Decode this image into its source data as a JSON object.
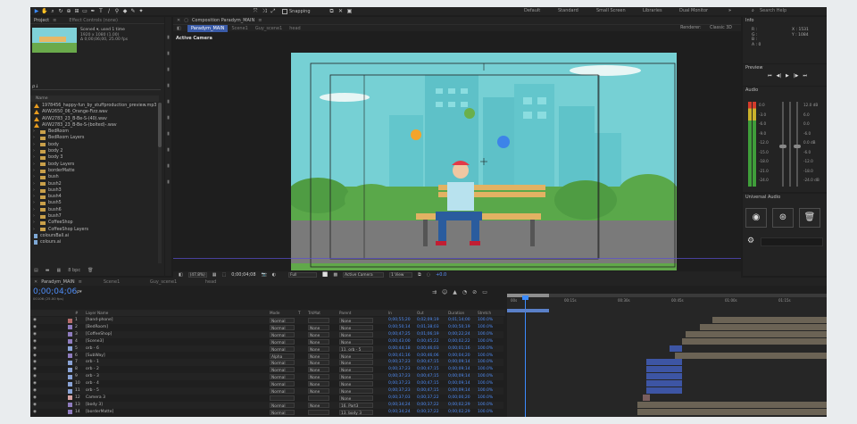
{
  "toolbar": {
    "snapping": "Snapping",
    "workspaces": [
      "Default",
      "Standard",
      "Small Screen",
      "Libraries",
      "Dual Monitor"
    ],
    "search_placeholder": "Search Help"
  },
  "project_panel": {
    "tab_project": "Project",
    "tab_effect_controls": "Effect Controls (none)",
    "selected_name": "Scene4 ▾, used 1 time",
    "selected_size": "1920 x 1080 (1.00)",
    "selected_duration": "Δ 0;00;06;00, 25.00 fps",
    "search_placeholder": "ρ↓",
    "column_name": "Name",
    "items": [
      {
        "name": "1978456_happy-fun_by_stuffproduction_preview.mp3",
        "type": "audio"
      },
      {
        "name": "AVW2650_06_Orange-Fizz.wav",
        "type": "audio"
      },
      {
        "name": "AVW2783_23_B-Be-S-(40).wav",
        "type": "audio"
      },
      {
        "name": "AVW2783_23_B-Be-S-(bolted)-.wav",
        "type": "audio"
      },
      {
        "name": "BedRoom",
        "type": "folder"
      },
      {
        "name": "BedRoom Layers",
        "type": "folder"
      },
      {
        "name": "body",
        "type": "folder"
      },
      {
        "name": "body 2",
        "type": "folder"
      },
      {
        "name": "body 3",
        "type": "folder"
      },
      {
        "name": "body Layers",
        "type": "folder"
      },
      {
        "name": "borderMatte",
        "type": "folder"
      },
      {
        "name": "bush",
        "type": "folder"
      },
      {
        "name": "bush2",
        "type": "folder"
      },
      {
        "name": "bush3",
        "type": "folder"
      },
      {
        "name": "bush4",
        "type": "folder"
      },
      {
        "name": "bush5",
        "type": "folder"
      },
      {
        "name": "bush6",
        "type": "folder"
      },
      {
        "name": "bush7",
        "type": "folder"
      },
      {
        "name": "CoffeeShop",
        "type": "folder"
      },
      {
        "name": "CoffeeShop Layers",
        "type": "folder"
      },
      {
        "name": "coloursBall.ai",
        "type": "file"
      },
      {
        "name": "colours.ai",
        "type": "file"
      }
    ],
    "bottom_bpc": "8 bpc"
  },
  "composition": {
    "panel_title": "Composition Paradym_MAIN",
    "breadcrumbs": [
      "Paradym_MAIN",
      "Scene1",
      "Guy_scene1",
      "head"
    ],
    "renderer_label": "Renderer:",
    "renderer_value": "Classic 3D",
    "active_camera": "Active Camera",
    "zoom": "(47.8%)",
    "timecode": "0;00;04;08",
    "resolution": "Full",
    "view_camera": "Active Camera",
    "views": "1 View",
    "exposure": "+0.0"
  },
  "info_panel": {
    "title": "Info",
    "r": "R :",
    "g": "G :",
    "b": "B :",
    "a": "A : 0",
    "x": "X : 1531",
    "y": "Y : 1084"
  },
  "preview_panel": {
    "title": "Preview"
  },
  "audio_panel": {
    "title": "Audio",
    "left_scale": [
      "0.0",
      "-3.0",
      "-6.0",
      "-9.0",
      "-12.0",
      "-15.0",
      "-18.0",
      "-21.0",
      "-24.0"
    ],
    "right_scale": [
      "12.0 dB",
      "6.0",
      "0.0",
      "-6.0",
      "0.0 dB",
      "-6.0",
      "-12.0",
      "-18.0",
      "-24.0 dB"
    ]
  },
  "universal_audio": {
    "title": "Universal Audio"
  },
  "timeline": {
    "tabs": [
      "Paradym_MAIN",
      "Scene1",
      "Guy_scene1",
      "head"
    ],
    "timecode": "0;00;04;06",
    "frame_info": "00106 (25.00 fps)",
    "columns": [
      "#",
      "Layer Name",
      "Mode",
      "T",
      "TrkMat",
      "Parent",
      "In",
      "Out",
      "Duration",
      "Stretch"
    ],
    "ruler": [
      "00s",
      "00:15s",
      "00:30s",
      "00:45s",
      "01:00s",
      "01:15s"
    ],
    "layers": [
      {
        "num": "1",
        "name": "[hand-phone]",
        "mode": "Normal",
        "trk": "",
        "parent": "None",
        "in": "0;00;55;20",
        "out": "0;02;09;19",
        "dur": "0;01;14;00",
        "stretch": "100.0%"
      },
      {
        "num": "2",
        "name": "[BedRoom]",
        "mode": "Normal",
        "trk": "None",
        "parent": "None",
        "in": "0;00;50;14",
        "out": "0;01;38;03",
        "dur": "0;00;50;19",
        "stretch": "100.0%"
      },
      {
        "num": "3",
        "name": "[CoffeeShop]",
        "mode": "Normal",
        "trk": "None",
        "parent": "None",
        "in": "0;00;47;25",
        "out": "0;01;06;19",
        "dur": "0;00;22;24",
        "stretch": "100.0%"
      },
      {
        "num": "4",
        "name": "[Scene3]",
        "mode": "Normal",
        "trk": "None",
        "parent": "None",
        "in": "0;00;43;00",
        "out": "0;00;45;22",
        "dur": "0;00;02;22",
        "stretch": "100.0%"
      },
      {
        "num": "5",
        "name": "orb - 6",
        "mode": "Normal",
        "trk": "None",
        "parent": "11. orb - 5",
        "in": "0;00;44;18",
        "out": "0;00;46;03",
        "dur": "0;00;01;16",
        "stretch": "100.0%"
      },
      {
        "num": "6",
        "name": "[SubWay]",
        "mode": "Alpha",
        "trk": "None",
        "parent": "None",
        "in": "0;00;41;16",
        "out": "0;00;46;06",
        "dur": "0;00;04;20",
        "stretch": "100.0%"
      },
      {
        "num": "7",
        "name": "orb - 1",
        "mode": "Normal",
        "trk": "None",
        "parent": "None",
        "in": "0;00;37;23",
        "out": "0;00;47;15",
        "dur": "0;00;09;14",
        "stretch": "100.0%"
      },
      {
        "num": "8",
        "name": "orb - 2",
        "mode": "Normal",
        "trk": "None",
        "parent": "None",
        "in": "0;00;37;23",
        "out": "0;00;47;15",
        "dur": "0;00;09;14",
        "stretch": "100.0%"
      },
      {
        "num": "9",
        "name": "orb - 3",
        "mode": "Normal",
        "trk": "None",
        "parent": "None",
        "in": "0;00;37;23",
        "out": "0;00;47;15",
        "dur": "0;00;09;14",
        "stretch": "100.0%"
      },
      {
        "num": "10",
        "name": "orb - 4",
        "mode": "Normal",
        "trk": "None",
        "parent": "None",
        "in": "0;00;37;23",
        "out": "0;00;47;15",
        "dur": "0;00;09;14",
        "stretch": "100.0%"
      },
      {
        "num": "11",
        "name": "orb - 5",
        "mode": "Normal",
        "trk": "None",
        "parent": "None",
        "in": "0;00;37;23",
        "out": "0;00;47;15",
        "dur": "0;00;09;14",
        "stretch": "100.0%"
      },
      {
        "num": "12",
        "name": "Camera 3",
        "mode": "",
        "trk": "",
        "parent": "None",
        "in": "0;00;37;03",
        "out": "0;00;37;22",
        "dur": "0;00;00;20",
        "stretch": "100.0%"
      },
      {
        "num": "13",
        "name": "[body 3]",
        "mode": "Normal",
        "trk": "None",
        "parent": "16. Part3",
        "in": "0;00;34;24",
        "out": "0;00;37;22",
        "dur": "0;00;02;29",
        "stretch": "100.0%"
      },
      {
        "num": "14",
        "name": "[borderMatte]",
        "mode": "Normal",
        "trk": "",
        "parent": "13. body 3",
        "in": "0;00;34;24",
        "out": "0;00;37;22",
        "dur": "0;00;02;29",
        "stretch": "100.0%"
      }
    ]
  }
}
